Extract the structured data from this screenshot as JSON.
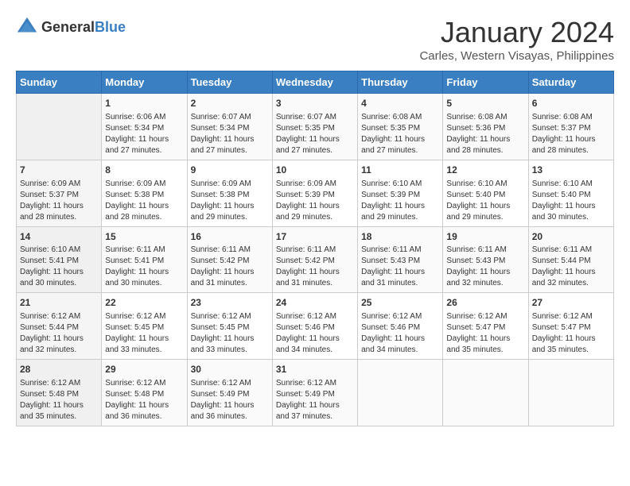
{
  "logo": {
    "general": "General",
    "blue": "Blue"
  },
  "title": "January 2024",
  "subtitle": "Carles, Western Visayas, Philippines",
  "days_of_week": [
    "Sunday",
    "Monday",
    "Tuesday",
    "Wednesday",
    "Thursday",
    "Friday",
    "Saturday"
  ],
  "weeks": [
    [
      {
        "day": "",
        "info": ""
      },
      {
        "day": "1",
        "info": "Sunrise: 6:06 AM\nSunset: 5:34 PM\nDaylight: 11 hours and 27 minutes."
      },
      {
        "day": "2",
        "info": "Sunrise: 6:07 AM\nSunset: 5:34 PM\nDaylight: 11 hours and 27 minutes."
      },
      {
        "day": "3",
        "info": "Sunrise: 6:07 AM\nSunset: 5:35 PM\nDaylight: 11 hours and 27 minutes."
      },
      {
        "day": "4",
        "info": "Sunrise: 6:08 AM\nSunset: 5:35 PM\nDaylight: 11 hours and 27 minutes."
      },
      {
        "day": "5",
        "info": "Sunrise: 6:08 AM\nSunset: 5:36 PM\nDaylight: 11 hours and 28 minutes."
      },
      {
        "day": "6",
        "info": "Sunrise: 6:08 AM\nSunset: 5:37 PM\nDaylight: 11 hours and 28 minutes."
      }
    ],
    [
      {
        "day": "7",
        "info": "Sunrise: 6:09 AM\nSunset: 5:37 PM\nDaylight: 11 hours and 28 minutes."
      },
      {
        "day": "8",
        "info": "Sunrise: 6:09 AM\nSunset: 5:38 PM\nDaylight: 11 hours and 28 minutes."
      },
      {
        "day": "9",
        "info": "Sunrise: 6:09 AM\nSunset: 5:38 PM\nDaylight: 11 hours and 29 minutes."
      },
      {
        "day": "10",
        "info": "Sunrise: 6:09 AM\nSunset: 5:39 PM\nDaylight: 11 hours and 29 minutes."
      },
      {
        "day": "11",
        "info": "Sunrise: 6:10 AM\nSunset: 5:39 PM\nDaylight: 11 hours and 29 minutes."
      },
      {
        "day": "12",
        "info": "Sunrise: 6:10 AM\nSunset: 5:40 PM\nDaylight: 11 hours and 29 minutes."
      },
      {
        "day": "13",
        "info": "Sunrise: 6:10 AM\nSunset: 5:40 PM\nDaylight: 11 hours and 30 minutes."
      }
    ],
    [
      {
        "day": "14",
        "info": "Sunrise: 6:10 AM\nSunset: 5:41 PM\nDaylight: 11 hours and 30 minutes."
      },
      {
        "day": "15",
        "info": "Sunrise: 6:11 AM\nSunset: 5:41 PM\nDaylight: 11 hours and 30 minutes."
      },
      {
        "day": "16",
        "info": "Sunrise: 6:11 AM\nSunset: 5:42 PM\nDaylight: 11 hours and 31 minutes."
      },
      {
        "day": "17",
        "info": "Sunrise: 6:11 AM\nSunset: 5:42 PM\nDaylight: 11 hours and 31 minutes."
      },
      {
        "day": "18",
        "info": "Sunrise: 6:11 AM\nSunset: 5:43 PM\nDaylight: 11 hours and 31 minutes."
      },
      {
        "day": "19",
        "info": "Sunrise: 6:11 AM\nSunset: 5:43 PM\nDaylight: 11 hours and 32 minutes."
      },
      {
        "day": "20",
        "info": "Sunrise: 6:11 AM\nSunset: 5:44 PM\nDaylight: 11 hours and 32 minutes."
      }
    ],
    [
      {
        "day": "21",
        "info": "Sunrise: 6:12 AM\nSunset: 5:44 PM\nDaylight: 11 hours and 32 minutes."
      },
      {
        "day": "22",
        "info": "Sunrise: 6:12 AM\nSunset: 5:45 PM\nDaylight: 11 hours and 33 minutes."
      },
      {
        "day": "23",
        "info": "Sunrise: 6:12 AM\nSunset: 5:45 PM\nDaylight: 11 hours and 33 minutes."
      },
      {
        "day": "24",
        "info": "Sunrise: 6:12 AM\nSunset: 5:46 PM\nDaylight: 11 hours and 34 minutes."
      },
      {
        "day": "25",
        "info": "Sunrise: 6:12 AM\nSunset: 5:46 PM\nDaylight: 11 hours and 34 minutes."
      },
      {
        "day": "26",
        "info": "Sunrise: 6:12 AM\nSunset: 5:47 PM\nDaylight: 11 hours and 35 minutes."
      },
      {
        "day": "27",
        "info": "Sunrise: 6:12 AM\nSunset: 5:47 PM\nDaylight: 11 hours and 35 minutes."
      }
    ],
    [
      {
        "day": "28",
        "info": "Sunrise: 6:12 AM\nSunset: 5:48 PM\nDaylight: 11 hours and 35 minutes."
      },
      {
        "day": "29",
        "info": "Sunrise: 6:12 AM\nSunset: 5:48 PM\nDaylight: 11 hours and 36 minutes."
      },
      {
        "day": "30",
        "info": "Sunrise: 6:12 AM\nSunset: 5:49 PM\nDaylight: 11 hours and 36 minutes."
      },
      {
        "day": "31",
        "info": "Sunrise: 6:12 AM\nSunset: 5:49 PM\nDaylight: 11 hours and 37 minutes."
      },
      {
        "day": "",
        "info": ""
      },
      {
        "day": "",
        "info": ""
      },
      {
        "day": "",
        "info": ""
      }
    ]
  ]
}
